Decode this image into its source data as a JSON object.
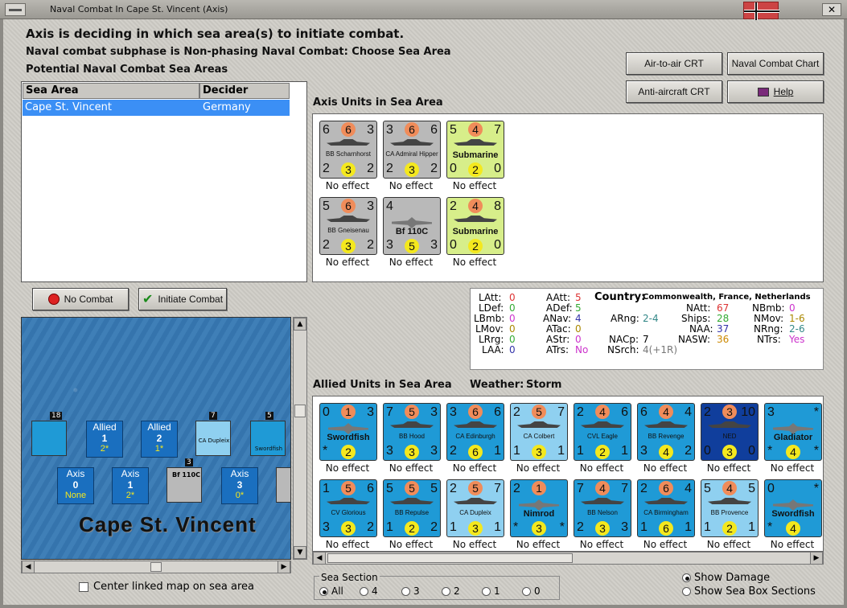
{
  "window": {
    "title": "Naval Combat In Cape St. Vincent (Axis)",
    "close_label": "✕"
  },
  "headers": {
    "line1": "Axis is deciding in which sea area(s) to initiate combat.",
    "line2": "Naval combat subphase is Non-phasing Naval Combat: Choose Sea Area",
    "line3": "Potential Naval Combat Sea Areas"
  },
  "buttons": {
    "air_to_air": "Air-to-air CRT",
    "naval_chart": "Naval Combat Chart",
    "anti_aircraft": "Anti-aircraft CRT",
    "help": "Help",
    "no_combat": "No Combat",
    "initiate_combat": "Initiate Combat"
  },
  "sea_table": {
    "col_sea": "Sea Area",
    "col_decider": "Decider",
    "rows": [
      {
        "sea": "Cape St. Vincent",
        "decider": "Germany"
      }
    ]
  },
  "axis_panel": {
    "label": "Axis Units in Sea Area",
    "units": [
      {
        "tl": "6",
        "tc": "6",
        "tr": "3",
        "name": "BB Scharnhorst",
        "bl": "2",
        "bc": "3",
        "br": "2",
        "effect": "No effect",
        "color": "gray"
      },
      {
        "tl": "3",
        "tc": "6",
        "tr": "6",
        "name": "CA Admiral Hipper",
        "bl": "2",
        "bc": "3",
        "br": "2",
        "effect": "No effect",
        "color": "gray"
      },
      {
        "tl": "5",
        "tc": "4",
        "tr": "7",
        "name": "Submarine",
        "bl": "0",
        "bc": "2",
        "br": "0",
        "effect": "No effect",
        "color": "green"
      },
      {
        "tl": "5",
        "tc": "6",
        "tr": "3",
        "name": "BB Gneisenau",
        "bl": "2",
        "bc": "3",
        "br": "2",
        "effect": "No effect",
        "color": "gray"
      },
      {
        "tl": "4",
        "tc": "",
        "tr": "",
        "name": "Bf 110C",
        "bl": "3",
        "bc": "5",
        "br": "3",
        "effect": "No effect",
        "color": "gray"
      },
      {
        "tl": "2",
        "tc": "4",
        "tr": "8",
        "name": "Submarine",
        "bl": "0",
        "bc": "2",
        "br": "0",
        "effect": "No effect",
        "color": "green"
      }
    ]
  },
  "stats": {
    "latt_l": "LAtt:",
    "latt": "0",
    "ldef_l": "LDef:",
    "ldef": "0",
    "lbmb_l": "LBmb:",
    "lbmb": "0",
    "lmov_l": "LMov:",
    "lmov": "0",
    "lrg_l": "LRrg:",
    "lrg": "0",
    "laa_l": "LAA:",
    "laa": "0",
    "aatt_l": "AAtt:",
    "aatt": "5",
    "adef_l": "ADef:",
    "adef": "5",
    "anav_l": "ANav:",
    "anav": "4",
    "atac_l": "ATac:",
    "atac": "0",
    "astr_l": "AStr:",
    "astr": "0",
    "atrs_l": "ATrs:",
    "atrs": "No",
    "country_l": "Country:",
    "country": "Commonwealth, France, Netherlands",
    "arng_l": "ARng:",
    "arng": "2-4",
    "nacp_l": "NACp:",
    "nacp": "7",
    "nsrch_l": "NSrch:",
    "nsrch": "4(+1R)",
    "natt_l": "NAtt:",
    "natt": "67",
    "ships_l": "Ships:",
    "ships": "28",
    "naa_l": "NAA:",
    "naa": "37",
    "nasw_l": "NASW:",
    "nasw": "36",
    "nbmb_l": "NBmb:",
    "nbmb": "0",
    "nmov_l": "NMov:",
    "nmov": "1-6",
    "nrng_l": "NRng:",
    "nrng": "2-6",
    "ntrs_l": "NTrs:",
    "ntrs": "Yes"
  },
  "allied_panel": {
    "label": "Allied Units in Sea Area",
    "weather_label": "Weather:",
    "weather": "Storm",
    "units": [
      {
        "tl": "0",
        "tc": "1",
        "tr": "3",
        "name": "Swordfish",
        "bl": "*",
        "bc": "2",
        "br": "",
        "effect": "No effect",
        "color": "blue"
      },
      {
        "tl": "7",
        "tc": "5",
        "tr": "3",
        "name": "BB Hood",
        "bl": "3",
        "bc": "3",
        "br": "3",
        "effect": "No effect",
        "color": "blue"
      },
      {
        "tl": "3",
        "tc": "6",
        "tr": "6",
        "name": "CA Edinburgh",
        "bl": "2",
        "bc": "6",
        "br": "1",
        "effect": "No effect",
        "color": "blue"
      },
      {
        "tl": "2",
        "tc": "5",
        "tr": "7",
        "name": "CA Colbert",
        "bl": "1",
        "bc": "3",
        "br": "1",
        "effect": "No effect",
        "color": "lblue"
      },
      {
        "tl": "2",
        "tc": "4",
        "tr": "6",
        "name": "CVL Eagle",
        "bl": "1",
        "bc": "2",
        "br": "1",
        "effect": "No effect",
        "color": "blue"
      },
      {
        "tl": "6",
        "tc": "4",
        "tr": "4",
        "name": "BB Revenge",
        "bl": "3",
        "bc": "4",
        "br": "2",
        "effect": "No effect",
        "color": "blue"
      },
      {
        "tl": "2",
        "tc": "3",
        "tr": "10",
        "name": "NED",
        "bl": "0",
        "bc": "3",
        "br": "0",
        "effect": "No effect",
        "color": "dblue"
      },
      {
        "tl": "3",
        "tc": "",
        "tr": "*",
        "name": "Gladiator",
        "bl": "*",
        "bc": "4",
        "br": "*",
        "effect": "No effect",
        "color": "blue"
      },
      {
        "tl": "1",
        "tc": "5",
        "tr": "6",
        "name": "CV Glorious",
        "bl": "3",
        "bc": "3",
        "br": "2",
        "effect": "No effect",
        "color": "blue"
      },
      {
        "tl": "5",
        "tc": "5",
        "tr": "5",
        "name": "BB Repulse",
        "bl": "1",
        "bc": "2",
        "br": "2",
        "effect": "No effect",
        "color": "blue"
      },
      {
        "tl": "2",
        "tc": "5",
        "tr": "7",
        "name": "CA Dupleix",
        "bl": "1",
        "bc": "3",
        "br": "1",
        "effect": "No effect",
        "color": "lblue"
      },
      {
        "tl": "2",
        "tc": "1",
        "tr": "",
        "name": "Nimrod",
        "bl": "*",
        "bc": "3",
        "br": "*",
        "effect": "No effect",
        "color": "blue"
      },
      {
        "tl": "7",
        "tc": "4",
        "tr": "7",
        "name": "BB Nelson",
        "bl": "2",
        "bc": "3",
        "br": "3",
        "effect": "No effect",
        "color": "blue"
      },
      {
        "tl": "2",
        "tc": "6",
        "tr": "4",
        "name": "CA Birmingham",
        "bl": "1",
        "bc": "6",
        "br": "1",
        "effect": "No effect",
        "color": "blue"
      },
      {
        "tl": "5",
        "tc": "4",
        "tr": "5",
        "name": "BB Provence",
        "bl": "1",
        "bc": "2",
        "br": "1",
        "effect": "No effect",
        "color": "lblue"
      },
      {
        "tl": "0",
        "tc": "",
        "tr": "*",
        "name": "Swordfish",
        "bl": "*",
        "bc": "4",
        "br": "",
        "effect": "No effect",
        "color": "blue"
      }
    ]
  },
  "map": {
    "label": "Cape St. Vincent",
    "stack_top": "18",
    "boxes": [
      {
        "side": "Allied",
        "num": "1",
        "note": "2*"
      },
      {
        "side": "Allied",
        "num": "2",
        "note": "1*"
      },
      {
        "side": "Axis",
        "num": "0",
        "note": "None"
      },
      {
        "side": "Axis",
        "num": "1",
        "note": "2*"
      },
      {
        "side": "Axis",
        "num": "3",
        "note": "0*"
      }
    ],
    "counters": [
      {
        "name": "CA Dupleix",
        "top": "7"
      },
      {
        "name": "Swordfish",
        "top": "5"
      },
      {
        "name": "Bf 110C",
        "top": "3"
      }
    ]
  },
  "options": {
    "center_linked": "Center linked map on sea area",
    "sea_section_label": "Sea Section",
    "sea_section": [
      "All",
      "4",
      "3",
      "2",
      "1",
      "0"
    ],
    "show_damage": "Show Damage",
    "show_sea_box": "Show Sea Box Sections"
  }
}
